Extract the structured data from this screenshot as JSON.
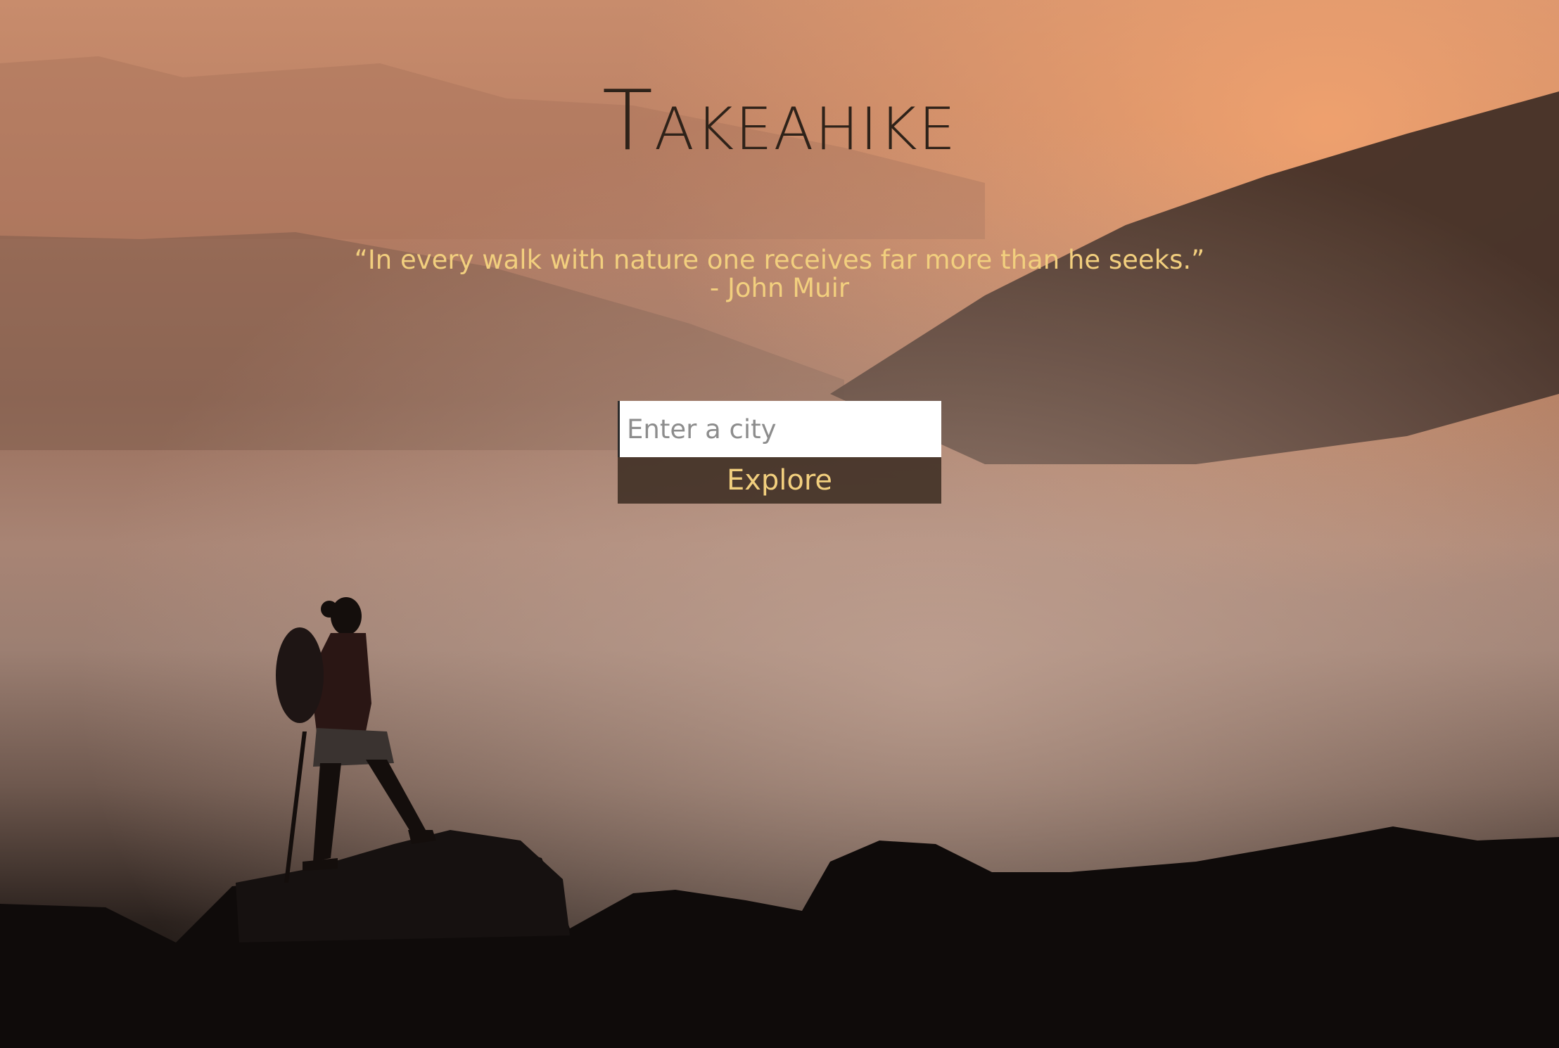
{
  "app": {
    "title": "Takeahike"
  },
  "quote": {
    "text": "“In every walk with nature one receives far more than he seeks.”",
    "author": "- John Muir"
  },
  "search": {
    "placeholder": "Enter a city",
    "value": "",
    "button_label": "Explore"
  },
  "colors": {
    "title": "#2e2219",
    "quote": "#f2cf7e",
    "button_bg": "#3a2a20",
    "button_text": "#f2cf7e"
  }
}
